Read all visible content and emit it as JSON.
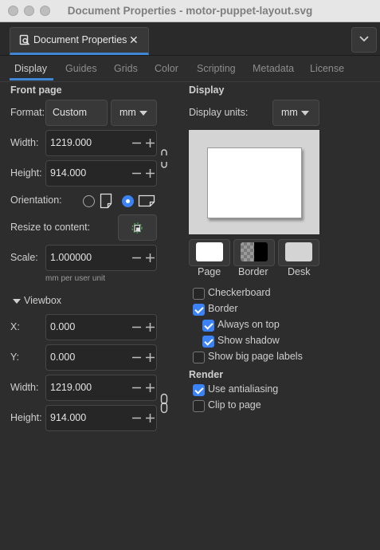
{
  "window": {
    "title": "Document Properties - motor-puppet-layout.svg"
  },
  "dock": {
    "tab_label": "Document Properties",
    "close": "✕"
  },
  "tabs": [
    {
      "label": "Display",
      "active": true
    },
    {
      "label": "Guides",
      "active": false
    },
    {
      "label": "Grids",
      "active": false
    },
    {
      "label": "Color",
      "active": false
    },
    {
      "label": "Scripting",
      "active": false
    },
    {
      "label": "Metadata",
      "active": false
    },
    {
      "label": "License",
      "active": false
    }
  ],
  "front_page": {
    "title": "Front page",
    "format_label": "Format:",
    "format_value": "Custom",
    "format_unit": "mm",
    "width_label": "Width:",
    "width_value": "1219.000",
    "height_label": "Height:",
    "height_value": "914.000",
    "orientation_label": "Orientation:",
    "orientation": "landscape",
    "resize_label": "Resize to content:",
    "scale_label": "Scale:",
    "scale_value": "1.000000",
    "scale_note": "mm per user unit"
  },
  "viewbox": {
    "title": "Viewbox",
    "x_label": "X:",
    "x_value": "0.000",
    "y_label": "Y:",
    "y_value": "0.000",
    "width_label": "Width:",
    "width_value": "1219.000",
    "height_label": "Height:",
    "height_value": "914.000"
  },
  "display": {
    "title": "Display",
    "units_label": "Display units:",
    "units_value": "mm",
    "swatches": [
      {
        "label": "Page",
        "color": "#ffffff"
      },
      {
        "label": "Border",
        "color": "#000000"
      },
      {
        "label": "Desk",
        "color": "#d4d4d4"
      }
    ],
    "checkboxes": [
      {
        "label": "Checkerboard",
        "checked": false
      },
      {
        "label": "Border",
        "checked": true
      },
      {
        "label": "Always on top",
        "checked": true
      },
      {
        "label": "Show shadow",
        "checked": true
      },
      {
        "label": "Show big page labels",
        "checked": false
      }
    ]
  },
  "render": {
    "title": "Render",
    "checkboxes": [
      {
        "label": "Use antialiasing",
        "checked": true
      },
      {
        "label": "Clip to page",
        "checked": false
      }
    ]
  },
  "colors": {
    "accent": "#3b82f6",
    "tab_underline": "#3f86d6",
    "background": "#2d2d2d"
  }
}
